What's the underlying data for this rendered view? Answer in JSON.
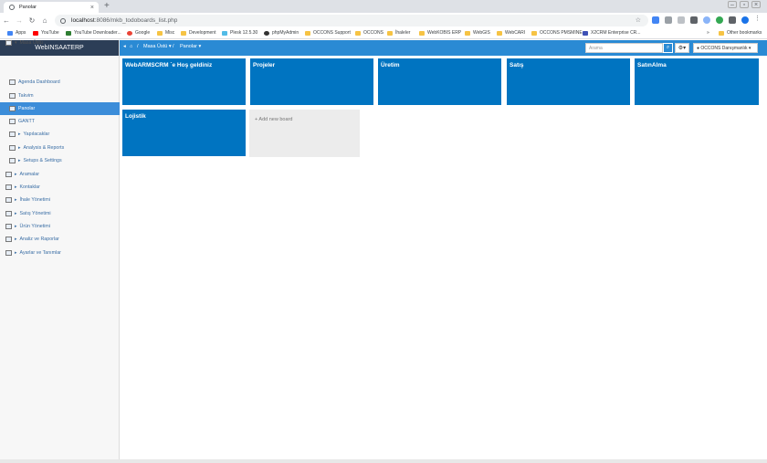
{
  "browser": {
    "tab_title": "Panolar",
    "url_host": "localhost",
    "url_path": ":8086/mkb_todoboards_list.php",
    "bookmarks": [
      "Apps",
      "YouTube",
      "YouTube Downloader...",
      "Google",
      "Misc",
      "Development",
      "Plesk 12.5.30",
      "phpMyAdmin",
      "OCCONS Support",
      "OCCONS",
      "İhaleler",
      "WebKOBIS ERP",
      "WebGIS",
      "WebCARI",
      "OCCONS PMSMINE",
      "X2CRM Enterprise CR...",
      "Other bookmarks"
    ]
  },
  "app": {
    "brand": "WebINSAATERP",
    "breadcrumb": {
      "home": "home-icon",
      "desk": "Masa Üstü",
      "boards": "Panolar",
      "sep": "/"
    },
    "search_placeholder": "Arama",
    "user_label": "OCCONS Danışmanlık"
  },
  "sidebar": {
    "items": [
      {
        "label": "Masa Üstü",
        "kind": "root"
      },
      {
        "label": "Agenda Dashboard",
        "kind": "child"
      },
      {
        "label": "Takvim",
        "kind": "child"
      },
      {
        "label": "Panolar",
        "kind": "child",
        "active": true
      },
      {
        "label": "GANTT",
        "kind": "child"
      },
      {
        "label": "Yapılacaklar",
        "kind": "child-caret"
      },
      {
        "label": "Analysis & Reports",
        "kind": "child-caret"
      },
      {
        "label": "Setups & Settings",
        "kind": "child-caret"
      },
      {
        "label": "Aramalar",
        "kind": "root-caret"
      },
      {
        "label": "Kontaklar",
        "kind": "root-caret"
      },
      {
        "label": "İhale Yönetimi",
        "kind": "root-caret"
      },
      {
        "label": "Satış Yönetimi",
        "kind": "root-caret"
      },
      {
        "label": "Ürün Yönetimi",
        "kind": "root-caret"
      },
      {
        "label": "Analiz ve Raporlar",
        "kind": "root-caret"
      },
      {
        "label": "Ayarlar ve Tanımlar",
        "kind": "root-caret"
      }
    ]
  },
  "boards": [
    "WebARMSCRM `e Hoş geldiniz",
    "Projeler",
    "Üretim",
    "Satış",
    "SatınAlma",
    "Lojistik"
  ],
  "add_board_label": "+ Add new board",
  "colors": {
    "board": "#0074c1",
    "nav": "#2a8ad4",
    "active": "#3c8dd9",
    "brand_bg": "#2c3e57"
  }
}
